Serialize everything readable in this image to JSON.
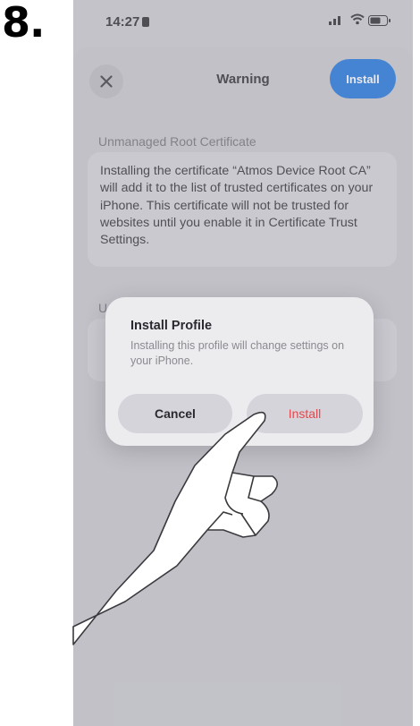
{
  "step": {
    "number": "8."
  },
  "status_bar": {
    "time": "14:27"
  },
  "sheet": {
    "title": "Warning",
    "install_label": "Install",
    "section_header": "Unmanaged Root Certificate",
    "cert_message": "Installing the certificate “Atmos Device Root CA” will add it to the list of trusted certificates on your iPhone. This certificate will not be trusted for websites until you enable it in Certificate Trust Settings."
  },
  "alert": {
    "title": "Install Profile",
    "message": "Installing this profile will change settings on your iPhone.",
    "cancel_label": "Cancel",
    "install_label": "Install"
  },
  "colors": {
    "accent": "#2f7fe0",
    "destructive": "#e5484d"
  },
  "icons": [
    "close-icon",
    "signal-icon",
    "wifi-icon",
    "battery-icon",
    "pointing-hand-icon"
  ]
}
